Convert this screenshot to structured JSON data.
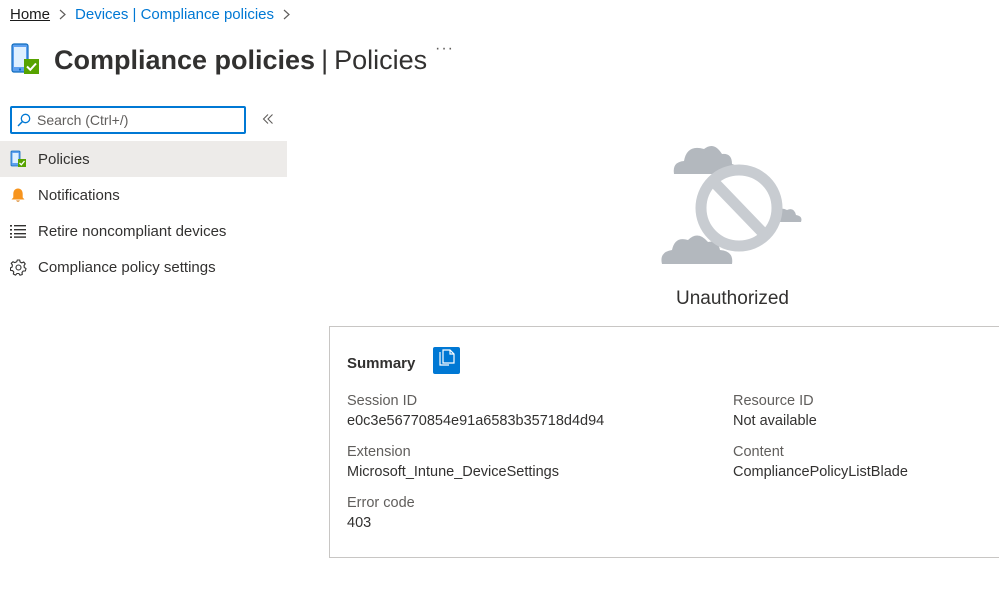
{
  "breadcrumb": {
    "home": "Home",
    "devices": "Devices | Compliance policies"
  },
  "header": {
    "title_main": "Compliance policies",
    "title_sep": "|",
    "title_sub": "Policies",
    "more": "···"
  },
  "search": {
    "placeholder": "Search (Ctrl+/)"
  },
  "sidebar": {
    "items": [
      {
        "label": "Policies",
        "icon": "device-compliance-icon",
        "active": true
      },
      {
        "label": "Notifications",
        "icon": "bell-icon"
      },
      {
        "label": "Retire noncompliant devices",
        "icon": "list-icon"
      },
      {
        "label": "Compliance policy settings",
        "icon": "gear-icon"
      }
    ]
  },
  "main": {
    "status": "Unauthorized",
    "status_icon": "blocked-cloud-icon"
  },
  "summary": {
    "title": "Summary",
    "copy_icon": "copy-icon",
    "session_id_label": "Session ID",
    "session_id": "e0c3e56770854e91a6583b35718d4d94",
    "extension_label": "Extension",
    "extension": "Microsoft_Intune_DeviceSettings",
    "error_code_label": "Error code",
    "error_code": "403",
    "resource_id_label": "Resource ID",
    "resource_id": "Not available",
    "content_label": "Content",
    "content": "CompliancePolicyListBlade"
  },
  "colors": {
    "accent": "#0078d4",
    "active_bg": "#edebe9",
    "check_green": "#57a300",
    "bell_orange": "#f7941d",
    "illustration_gray": "#b3b8be"
  }
}
